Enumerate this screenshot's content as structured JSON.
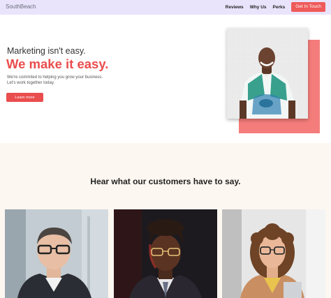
{
  "nav": {
    "brand": "SouthBeach",
    "links": [
      "Reviews",
      "Why Us",
      "Perks"
    ],
    "cta": "Get In Touch"
  },
  "hero": {
    "subtitle": "Marketing isn't easy.",
    "title": "We make it easy.",
    "description": "We're commited to helping you grow your business. Let's work together today.",
    "button": "Learn more"
  },
  "testimonials": {
    "title": "Hear what our customers have to say."
  },
  "colors": {
    "accent": "#ea4d4d",
    "nav_bg": "#e9e4fb",
    "section_bg": "#fdf7f1"
  }
}
